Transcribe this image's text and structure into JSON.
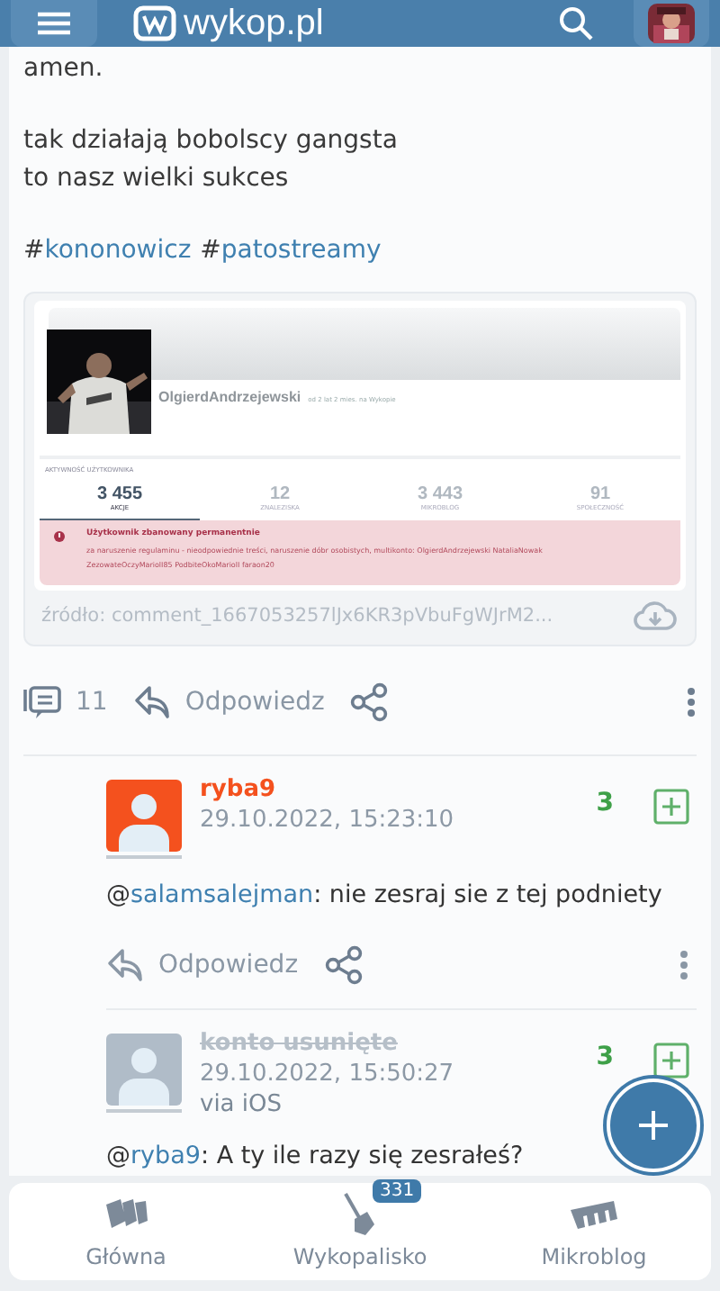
{
  "header": {
    "logo_text": "wykop.pl"
  },
  "post": {
    "paragraphs": [
      [
        "amen."
      ],
      [
        "tak działają bobolscy gangsta",
        "to nasz wielki sukces"
      ]
    ],
    "tags": [
      {
        "hash": "#",
        "name": "kononowicz"
      },
      {
        "hash": "#",
        "name": "patostreamy"
      }
    ],
    "embed": {
      "username": "OlgierdAndrzejewski",
      "since": "od 2 lat 2 mies. na Wykopie",
      "activity_label": "AKTYWNOŚĆ UŻYTKOWNIKA",
      "stats": [
        {
          "value": "3 455",
          "label": "AKCJE",
          "selected": true
        },
        {
          "value": "12",
          "label": "ZNALEZISKA",
          "selected": false
        },
        {
          "value": "3 443",
          "label": "MIKROBLOG",
          "selected": false
        },
        {
          "value": "91",
          "label": "SPOŁECZNOŚĆ",
          "selected": false
        }
      ],
      "ban_title": "Użytkownik zbanowany permanentnie",
      "ban_reason": "za naruszenie regulaminu - nieodpowiednie treści, naruszenie dóbr osobistych, multikonto: OlgierdAndrzejewski NataliaNowak ZezowateOczyMariolI85 PodbiteOkoMariolI faraon20",
      "source": "źródło: comment_1667053257lJx6KR3pVbuFgWJrM2..."
    },
    "comment_count": "11",
    "reply": "Odpowiedz"
  },
  "comments": [
    {
      "author": "ryba9",
      "deleted": false,
      "color": "#f4511e",
      "date": "29.10.2022, 15:23:10",
      "score": "3",
      "at": "@",
      "mention": "salamsalejman",
      "text": ": nie zesraj sie z tej podniety",
      "reply": "Odpowiedz"
    },
    {
      "author": "konto usunięte",
      "deleted": true,
      "color": "#b0bcc8",
      "date": "29.10.2022, 15:50:27",
      "via": "via iOS",
      "score": "3",
      "at": "@",
      "mention": "ryba9",
      "text": ": A ty ile razy się zesrałeś?"
    }
  ],
  "nav": [
    {
      "label": "Główna"
    },
    {
      "label": "Wykopalisko",
      "badge": "331"
    },
    {
      "label": "Mikroblog"
    }
  ]
}
